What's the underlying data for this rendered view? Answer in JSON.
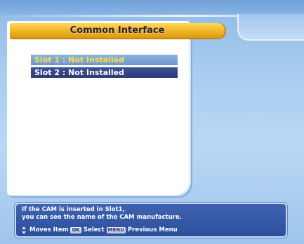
{
  "title": "Common Interface",
  "slots": [
    {
      "label": "Slot 1 : Not Installed"
    },
    {
      "label": "Slot 2 : Not Installed"
    }
  ],
  "help": {
    "line1": "If the CAM is inserted in Slot1,",
    "line2": "you can see the name of the CAM manufacture.",
    "keys": [
      {
        "icon": "up-down-arrows-icon",
        "label": "Moves Item"
      },
      {
        "badge": "OK",
        "label": "Select"
      },
      {
        "badge": "MENU",
        "label": "Previous Menu"
      }
    ]
  },
  "colors": {
    "title_bar": "#f2b92c",
    "selected_slot_text": "#ffe23a",
    "slot_text": "#ffffff",
    "help_bg": "#2c4f9e"
  }
}
